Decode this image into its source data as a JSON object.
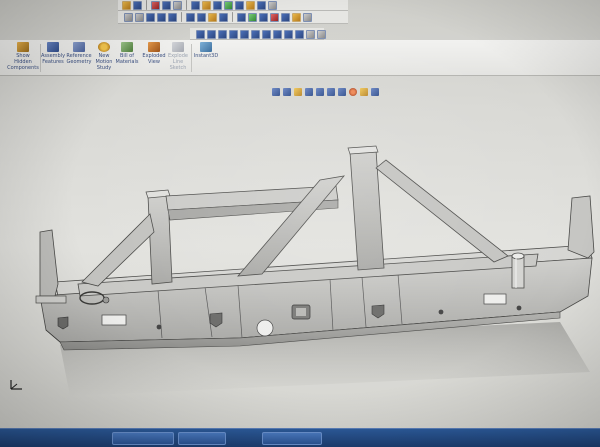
{
  "ribbon": {
    "buttons": [
      {
        "label": "Show\nHidden\nComponents",
        "icon": "show-hidden-components-icon",
        "enabled": true
      },
      {
        "label": "Assembly\nFeatures",
        "icon": "assembly-features-icon",
        "enabled": true
      },
      {
        "label": "Reference\nGeometry",
        "icon": "reference-geometry-icon",
        "enabled": true
      },
      {
        "label": "New\nMotion\nStudy",
        "icon": "new-motion-study-icon",
        "enabled": true
      },
      {
        "label": "Bill of\nMaterials",
        "icon": "bill-of-materials-icon",
        "enabled": true
      },
      {
        "label": "Exploded\nView",
        "icon": "exploded-view-icon",
        "enabled": true
      },
      {
        "label": "Explode\nLine\nSketch",
        "icon": "explode-line-sketch-icon",
        "enabled": false
      },
      {
        "label": "Instant3D",
        "icon": "instant3d-icon",
        "enabled": true
      }
    ]
  },
  "colors": {
    "background": "#dcdcd8",
    "model_face": "#c2c2bf",
    "model_edge": "#4a4a48",
    "taskbar": "#234a86",
    "toolbar_icon": "#3d5ea3"
  },
  "triad": {
    "icon": "coordinate-triad-icon"
  },
  "taskbar": {
    "items": [
      "",
      "",
      ""
    ]
  }
}
